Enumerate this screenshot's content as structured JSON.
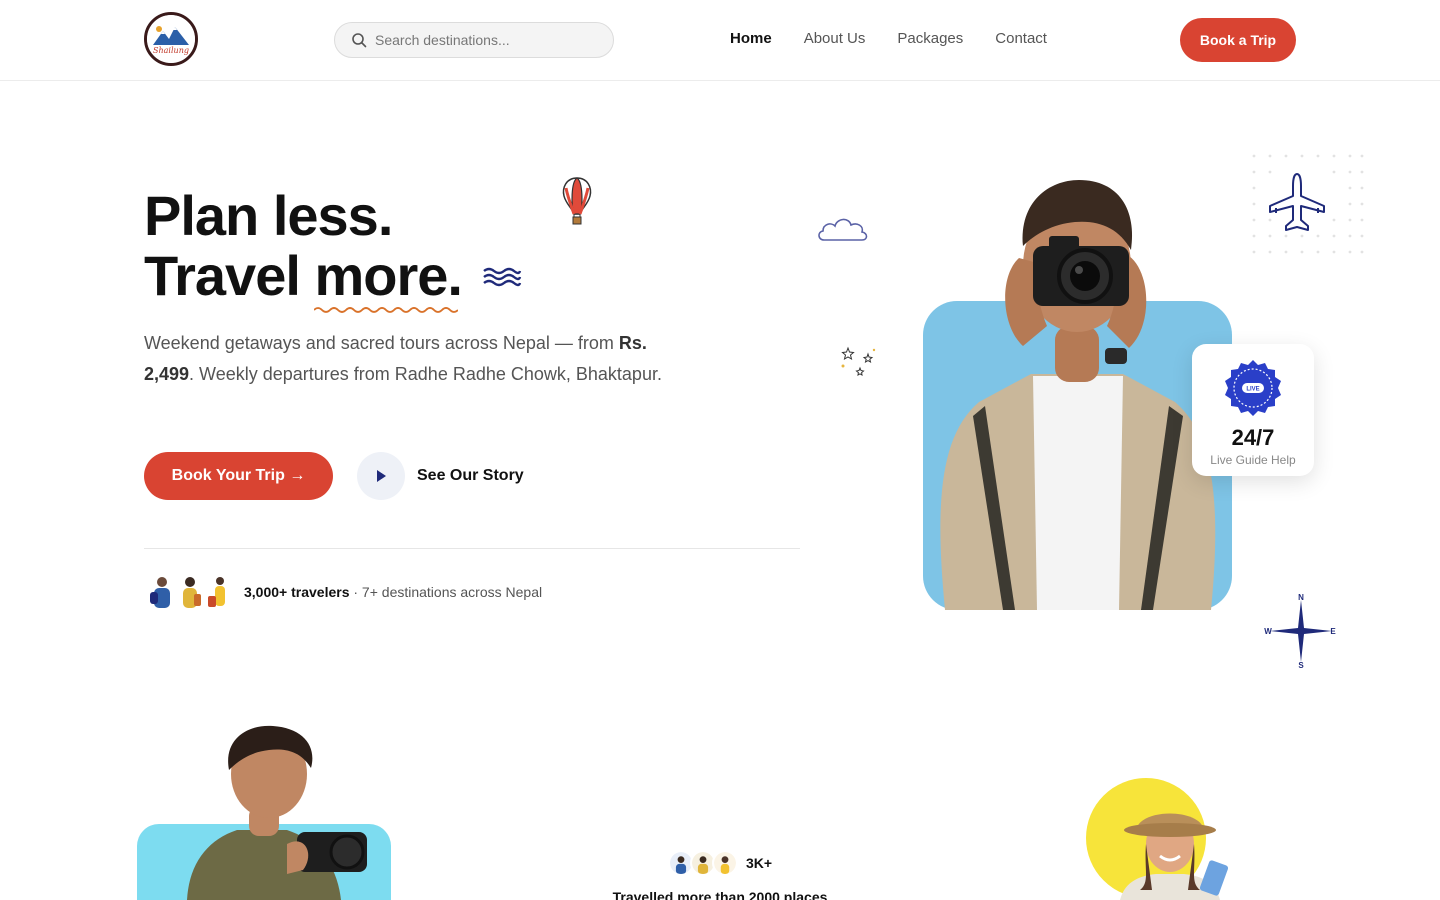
{
  "header": {
    "logo_text": "Shailung",
    "search_placeholder": "Search destinations...",
    "nav": [
      {
        "label": "Home",
        "active": true
      },
      {
        "label": "About Us",
        "active": false
      },
      {
        "label": "Packages",
        "active": false
      },
      {
        "label": "Contact",
        "active": false
      }
    ],
    "cta_label": "Book a Trip"
  },
  "hero": {
    "title_line1": "Plan less.",
    "title_line2_a": "Travel ",
    "title_line2_b": "more.",
    "desc_part1": "Weekend getaways and sacred tours across Nepal — from ",
    "desc_price": "Rs. 2,499",
    "desc_part2": ". Weekly departures from Radhe Radhe Chowk, Bhaktapur.",
    "primary_button": "Book Your Trip →",
    "secondary_button": "See Our Story",
    "social_bold": "3,000+ travelers",
    "social_rest": " · 7+ destinations across Nepal"
  },
  "live_card": {
    "badge_text": "LIVE",
    "value": "24/7",
    "label": "Live Guide Help"
  },
  "compass": {
    "n": "N",
    "s": "S",
    "e": "E",
    "w": "W"
  },
  "stats": {
    "count": "3K+",
    "line": "Travelled more than 2000 places"
  },
  "colors": {
    "accent": "#d94432",
    "navy": "#1f2a7a",
    "sky": "#7ec4e6",
    "sun": "#f7e43a"
  }
}
